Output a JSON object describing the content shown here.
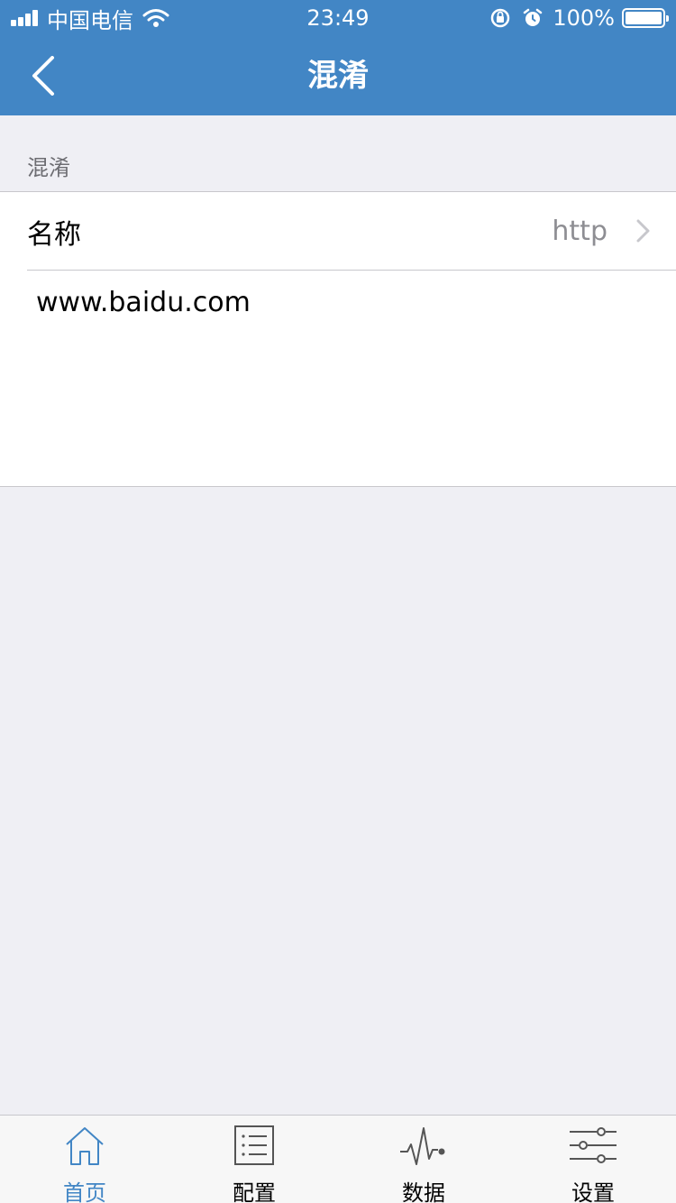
{
  "status_bar": {
    "carrier": "中国电信",
    "time": "23:49",
    "battery": "100%"
  },
  "nav": {
    "title": "混淆"
  },
  "section": {
    "label": "混淆"
  },
  "row": {
    "label": "名称",
    "value": "http"
  },
  "text_content": "www.baidu.com",
  "tabs": [
    {
      "label": "首页",
      "icon": "home-icon",
      "active": true
    },
    {
      "label": "配置",
      "icon": "list-icon",
      "active": false
    },
    {
      "label": "数据",
      "icon": "pulse-icon",
      "active": false
    },
    {
      "label": "设置",
      "icon": "sliders-icon",
      "active": false
    }
  ],
  "colors": {
    "primary": "#4286c5",
    "background": "#efeff4",
    "separator": "#c8c7cc",
    "secondary_text": "#8e8e93"
  }
}
